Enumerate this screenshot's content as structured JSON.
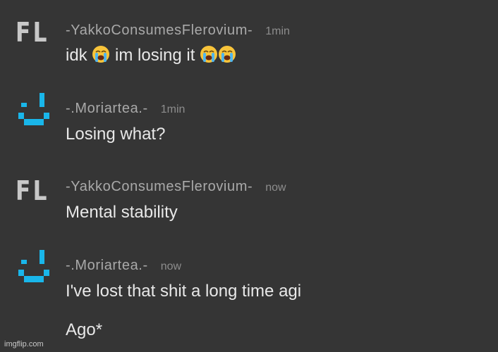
{
  "messages": [
    {
      "avatar_text": "FL",
      "avatar_icon": "fl-text-avatar",
      "username": "-YakkoConsumesFlerovium-",
      "time": "1min",
      "lines": [
        "idk",
        "im losing it"
      ],
      "emoji": "loudly-crying-face-icon"
    },
    {
      "avatar_icon": "smiley-pixel-avatar",
      "username": "-.Moriartea.-",
      "time": "1min",
      "lines": [
        "Losing what?"
      ]
    },
    {
      "avatar_text": "FL",
      "avatar_icon": "fl-text-avatar",
      "username": "-YakkoConsumesFlerovium-",
      "time": "now",
      "lines": [
        "Mental stability"
      ]
    },
    {
      "avatar_icon": "smiley-pixel-avatar",
      "username": "-.Moriartea.-",
      "time": "now",
      "lines": [
        "I've lost that shit a long time agi",
        "Ago*"
      ]
    }
  ],
  "footer": "imgflip.com",
  "colors": {
    "background": "#353535",
    "username": "#a9a9a9",
    "timestamp": "#8d8d8d",
    "message_text": "#e8e8e8",
    "avatar_cyan": "#19b6ea",
    "avatar_grey": "#c8c8c8"
  }
}
